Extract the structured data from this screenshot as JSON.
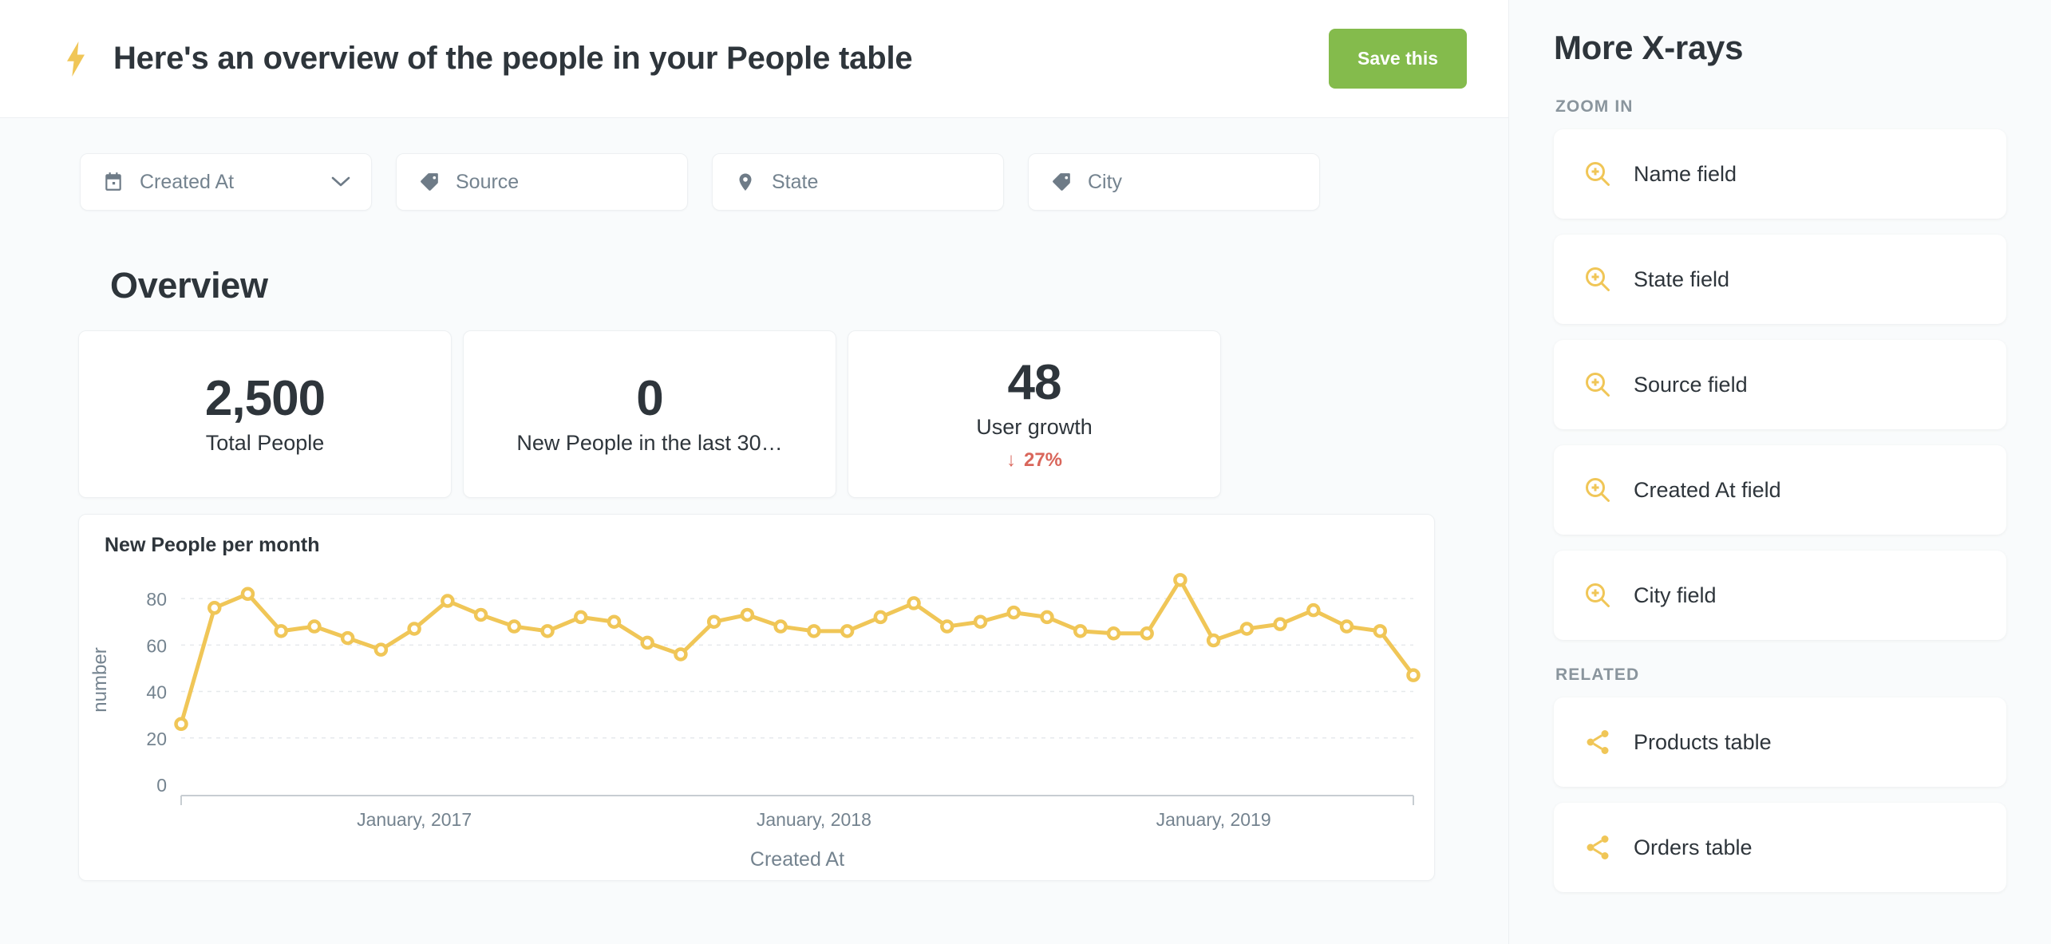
{
  "header": {
    "bolt_icon": "lightning-bolt-icon",
    "title": "Here's an overview of the people in your People table",
    "save_label": "Save this"
  },
  "filters": [
    {
      "label": "Created At",
      "icon": "calendar-icon",
      "has_chevron": true
    },
    {
      "label": "Source",
      "icon": "tag-icon",
      "has_chevron": false
    },
    {
      "label": "State",
      "icon": "map-pin-icon",
      "has_chevron": false
    },
    {
      "label": "City",
      "icon": "tag-icon",
      "has_chevron": false
    }
  ],
  "overview": {
    "heading": "Overview",
    "cards": [
      {
        "value": "2,500",
        "label": "Total People"
      },
      {
        "value": "0",
        "label": "New People in the last 30…"
      },
      {
        "value": "48",
        "label": "User growth",
        "delta": "27%",
        "delta_arrow": "↓",
        "delta_color": "#D9665B"
      }
    ]
  },
  "sidebar": {
    "title": "More X-rays",
    "sections": [
      {
        "heading": "ZOOM IN",
        "items": [
          {
            "label": "Name field",
            "icon": "zoom-in-icon"
          },
          {
            "label": "State field",
            "icon": "zoom-in-icon"
          },
          {
            "label": "Source field",
            "icon": "zoom-in-icon"
          },
          {
            "label": "Created At field",
            "icon": "zoom-in-icon"
          },
          {
            "label": "City field",
            "icon": "zoom-in-icon"
          }
        ]
      },
      {
        "heading": "RELATED",
        "items": [
          {
            "label": "Products table",
            "icon": "share-nodes-icon"
          },
          {
            "label": "Orders table",
            "icon": "share-nodes-icon"
          }
        ]
      }
    ]
  },
  "colors": {
    "accent_yellow": "#F0C657",
    "brand_green": "#84BB4C",
    "danger_red": "#D9665B",
    "text_dark": "#2E353B",
    "text_muted": "#74838F",
    "page_bg": "#F9FBFC"
  },
  "chart_data": {
    "type": "line",
    "title": "New People per month",
    "xlabel": "Created At",
    "ylabel": "number",
    "ylim": [
      0,
      90
    ],
    "yticks": [
      0,
      20,
      40,
      60,
      80
    ],
    "grid": true,
    "legend": null,
    "line_color": "#F0C657",
    "marker": "open-circle",
    "xtick_labels": [
      "January, 2017",
      "January, 2018",
      "January, 2019"
    ],
    "xtick_indices": [
      7,
      19,
      31
    ],
    "x": [
      "August, 2016",
      "September, 2016",
      "October, 2016",
      "November, 2016",
      "December, 2016",
      "January, 2017",
      "February, 2017",
      "March, 2017",
      "April, 2017",
      "May, 2017",
      "June, 2017",
      "July, 2017",
      "August, 2017",
      "September, 2017",
      "October, 2017",
      "November, 2017",
      "December, 2017",
      "January, 2018",
      "February, 2018",
      "March, 2018",
      "April, 2018",
      "May, 2018",
      "June, 2018",
      "July, 2018",
      "August, 2018",
      "September, 2018",
      "October, 2018",
      "November, 2018",
      "December, 2018",
      "January, 2019",
      "February, 2019",
      "March, 2019",
      "April, 2019",
      "May, 2019",
      "June, 2019",
      "July, 2019",
      "August, 2019"
    ],
    "values": [
      26,
      76,
      82,
      66,
      68,
      63,
      58,
      67,
      79,
      73,
      68,
      66,
      72,
      70,
      61,
      56,
      70,
      73,
      68,
      66,
      66,
      72,
      78,
      68,
      70,
      74,
      72,
      66,
      65,
      65,
      88,
      62,
      67,
      69,
      75,
      68,
      66,
      47
    ]
  }
}
